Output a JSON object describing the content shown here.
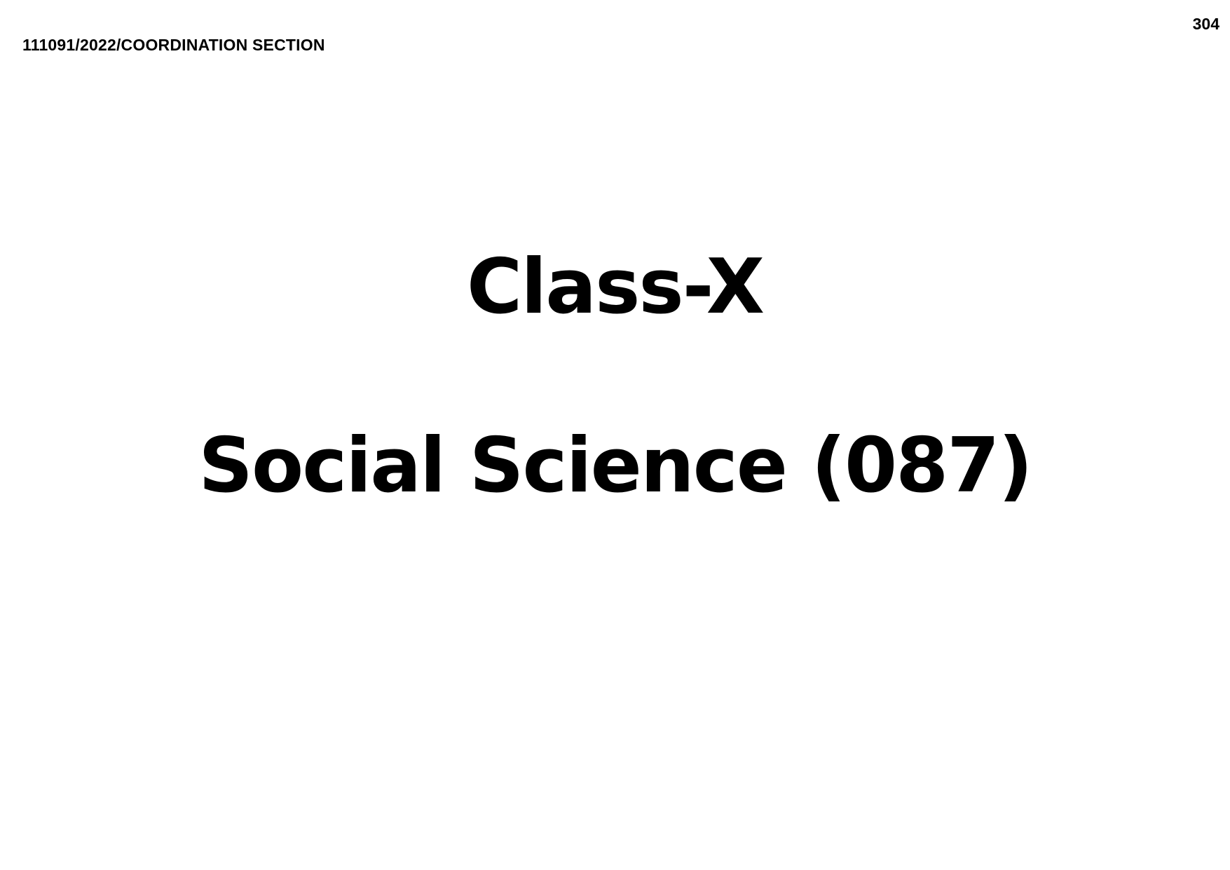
{
  "header": {
    "file_reference": "111091/2022/COORDINATION SECTION",
    "page_number": "304"
  },
  "main": {
    "class_title": "Class-X",
    "subject_title": "Social Science (087)"
  }
}
